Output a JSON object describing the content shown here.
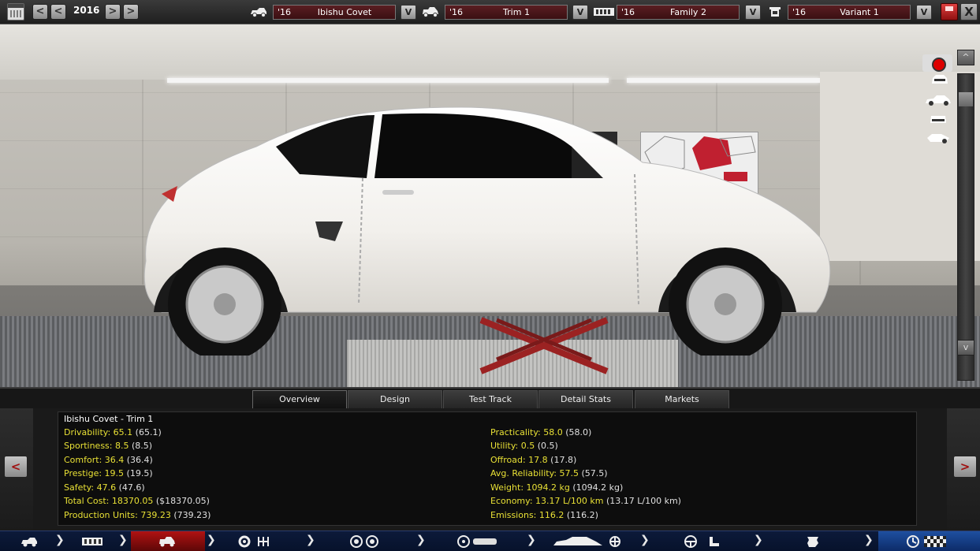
{
  "topbar": {
    "year": "2016",
    "model": {
      "year": "'16",
      "name": "Ibishu Covet"
    },
    "trim": {
      "year": "'16",
      "name": "Trim 1"
    },
    "family": {
      "year": "'16",
      "name": "Family 2"
    },
    "variant": {
      "year": "'16",
      "name": "Variant 1"
    },
    "prev_label": "<",
    "next_label": ">",
    "dropdown_label": "V",
    "close_label": "X"
  },
  "viewport": {
    "scroll_up": "^",
    "scroll_down": "v"
  },
  "tabs": [
    {
      "label": "Overview",
      "active": true
    },
    {
      "label": "Design",
      "active": false
    },
    {
      "label": "Test Track",
      "active": false
    },
    {
      "label": "Detail Stats",
      "active": false
    },
    {
      "label": "Markets",
      "active": false
    }
  ],
  "stats": {
    "title": "Ibishu Covet - Trim 1",
    "left": [
      {
        "label": "Drivability: 65.1",
        "paren": "(65.1)"
      },
      {
        "label": "Sportiness: 8.5",
        "paren": "(8.5)"
      },
      {
        "label": "Comfort: 36.4",
        "paren": "(36.4)"
      },
      {
        "label": "Prestige: 19.5",
        "paren": "(19.5)"
      },
      {
        "label": "Safety: 47.6",
        "paren": "(47.6)"
      },
      {
        "label": "Total Cost: 18370.05",
        "paren": "($18370.05)"
      },
      {
        "label": "Production Units: 739.23",
        "paren": "(739.23)"
      }
    ],
    "right": [
      {
        "label": "Practicality: 58.0",
        "paren": "(58.0)"
      },
      {
        "label": "Utility: 0.5",
        "paren": "(0.5)"
      },
      {
        "label": "Offroad: 17.8",
        "paren": "(17.8)"
      },
      {
        "label": "Avg. Reliability: 57.5",
        "paren": "(57.5)"
      },
      {
        "label": "Weight: 1094.2 kg",
        "paren": "(1094.2 kg)"
      },
      {
        "label": "Economy: 13.17 L/100 km",
        "paren": "(13.17 L/100 km)"
      },
      {
        "label": "Emissions: 116.2",
        "paren": "(116.2)"
      }
    ],
    "prev_label": "<",
    "next_label": ">"
  },
  "colors": {
    "stat_label": "#e8e035",
    "active_nav": "#b01212",
    "nav_bg": "#0c1a3a"
  }
}
